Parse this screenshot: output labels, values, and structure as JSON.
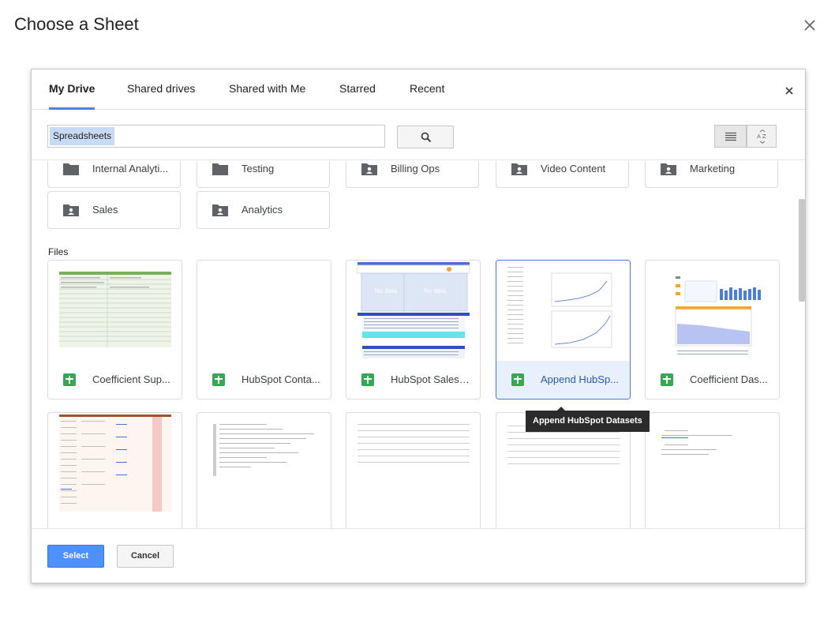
{
  "dialog": {
    "title": "Choose a Sheet"
  },
  "picker": {
    "tabs": [
      {
        "label": "My Drive",
        "active": true
      },
      {
        "label": "Shared drives",
        "active": false
      },
      {
        "label": "Shared with Me",
        "active": false
      },
      {
        "label": "Starred",
        "active": false
      },
      {
        "label": "Recent",
        "active": false
      }
    ],
    "search": {
      "value": "Spreadsheets"
    },
    "folders": [
      {
        "name": "Internal Analyti...",
        "shared": false
      },
      {
        "name": "Testing",
        "shared": false
      },
      {
        "name": "Billing Ops",
        "shared": true
      },
      {
        "name": "Video Content",
        "shared": true
      },
      {
        "name": "Marketing",
        "shared": true
      },
      {
        "name": "Sales",
        "shared": true
      },
      {
        "name": "Analytics",
        "shared": true
      }
    ],
    "files_label": "Files",
    "files": [
      {
        "name": "Coefficient Sup...",
        "selected": false
      },
      {
        "name": "HubSpot Conta...",
        "selected": false
      },
      {
        "name": "HubSpot Sales ...",
        "selected": false
      },
      {
        "name": "Append HubSp...",
        "selected": true
      },
      {
        "name": "Coefficient Das...",
        "selected": false
      }
    ],
    "thumb_texts": {
      "no_data_1": "No data",
      "no_data_2": "No data"
    },
    "tooltip": "Append HubSpot Datasets",
    "footer": {
      "select_label": "Select",
      "cancel_label": "Cancel"
    },
    "colors": {
      "accent": "#4285f4",
      "select_button": "#4d90fe",
      "sheets_green": "#34a853",
      "selected_border": "#4a7bd9"
    }
  }
}
